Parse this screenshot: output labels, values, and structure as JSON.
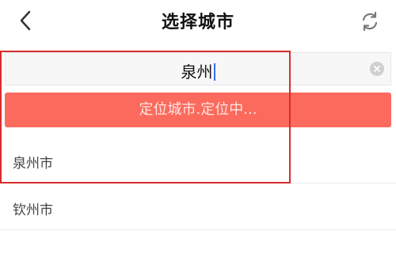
{
  "header": {
    "title": "选择城市",
    "back_icon": "chevron-left-icon",
    "refresh_icon": "refresh-icon"
  },
  "search": {
    "value": "泉州",
    "clear_icon": "clear-circle-icon"
  },
  "locate_button": {
    "label": "定位城市.定位中..."
  },
  "results": [
    {
      "label": "泉州市"
    },
    {
      "label": "钦州市"
    }
  ],
  "colors": {
    "accent": "#fb6a5d",
    "highlight_box": "#d82c2c",
    "caret": "#3c6cf0"
  }
}
